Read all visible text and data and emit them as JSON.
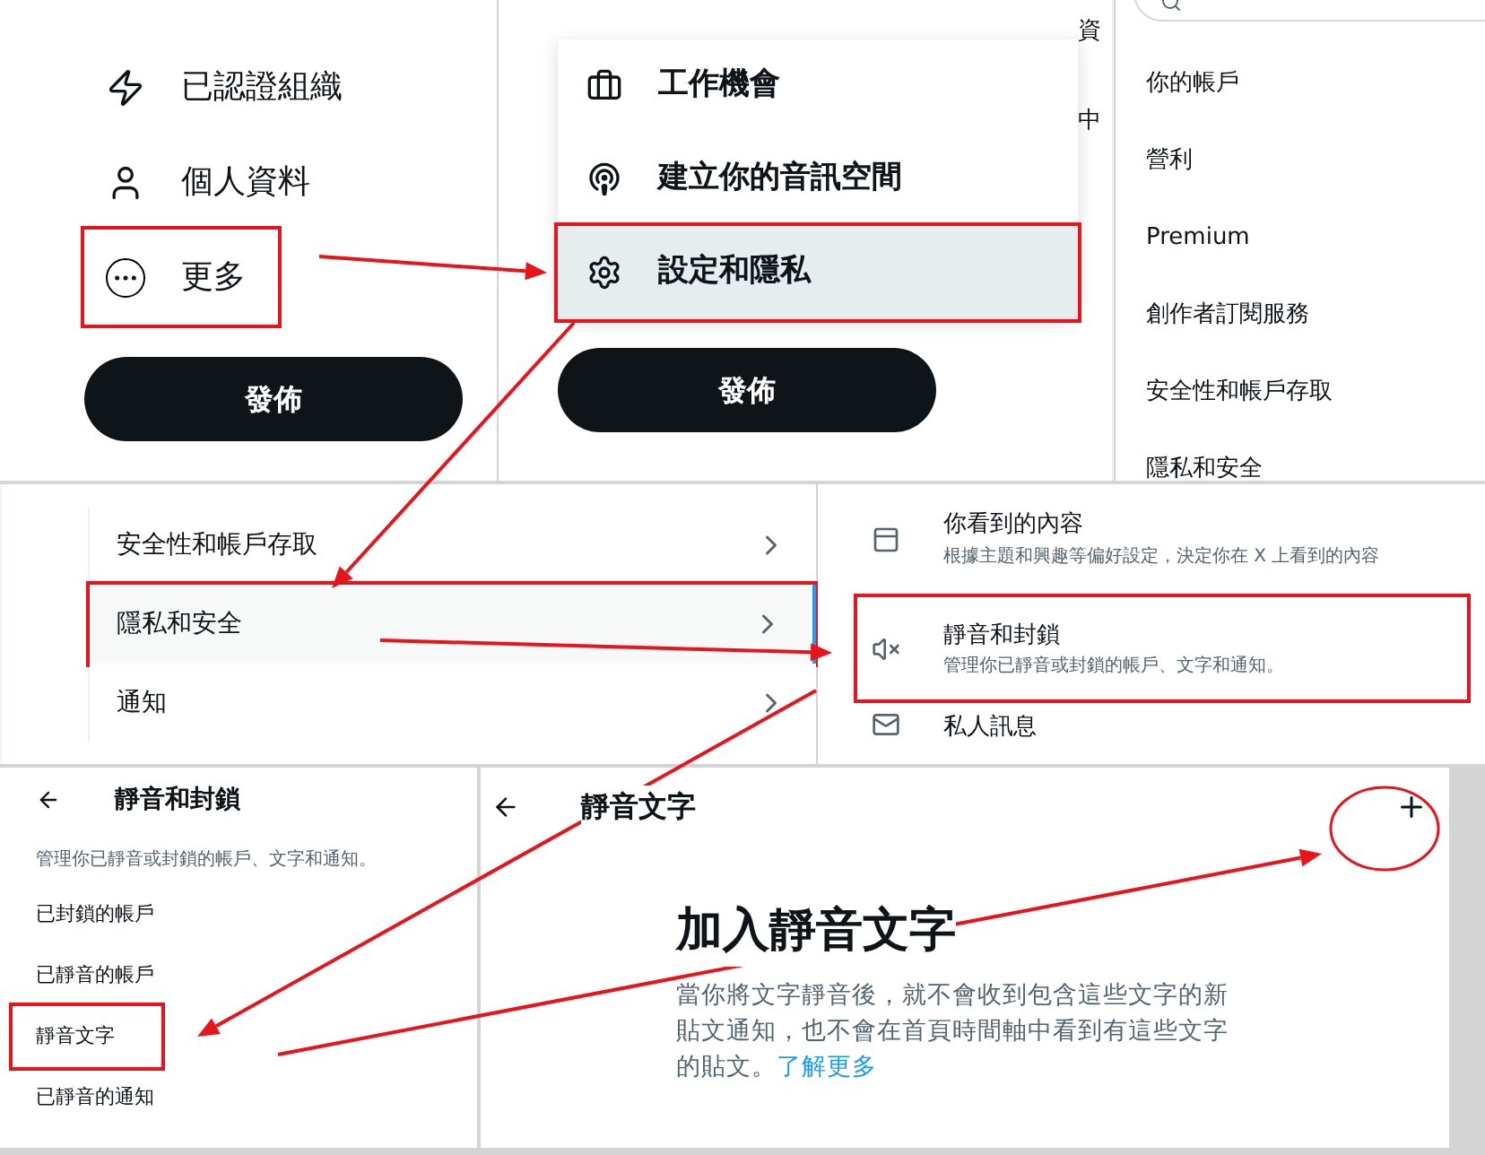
{
  "profile_menu": {
    "items": [
      {
        "label": "已認證組織",
        "annotated": false
      },
      {
        "label": "個人資料",
        "annotated": false
      },
      {
        "label": "更多",
        "annotated": true
      }
    ],
    "post_button": "發佈"
  },
  "more_menu": {
    "items": [
      {
        "label": "工作機會",
        "selected": false,
        "annotated": false
      },
      {
        "label": "建立你的音訊空間",
        "selected": false,
        "annotated": false
      },
      {
        "label": "設定和隱私",
        "selected": true,
        "annotated": true
      }
    ],
    "post_button": "發佈",
    "side_fragments": [
      "資",
      "中"
    ]
  },
  "settings_nav": {
    "items": [
      "你的帳戶",
      "營利",
      "Premium",
      "創作者訂閱服務",
      "安全性和帳戶存取",
      "隱私和安全"
    ]
  },
  "settings_list": {
    "items": [
      {
        "label": "安全性和帳戶存取",
        "selected": false,
        "annotated": false
      },
      {
        "label": "隱私和安全",
        "selected": true,
        "annotated": true
      },
      {
        "label": "通知",
        "selected": false,
        "annotated": false
      }
    ]
  },
  "privacy_list": {
    "items": [
      {
        "title": "你看到的內容",
        "description": "根據主題和興趣等偏好設定，決定你在 X 上看到的內容",
        "annotated": false
      },
      {
        "title": "靜音和封鎖",
        "description": "管理你已靜音或封鎖的帳戶、文字和通知。",
        "annotated": true
      },
      {
        "title": "私人訊息",
        "annotated": false
      }
    ]
  },
  "mute_block": {
    "title": "靜音和封鎖",
    "description": "管理你已靜音或封鎖的帳戶、文字和通知。",
    "items": [
      {
        "label": "已封鎖的帳戶",
        "annotated": false
      },
      {
        "label": "已靜音的帳戶",
        "annotated": false
      },
      {
        "label": "靜音文字",
        "annotated": true
      },
      {
        "label": "已靜音的通知",
        "annotated": false
      }
    ]
  },
  "muted_words": {
    "title": "靜音文字",
    "add_annotated": true,
    "empty_title": "加入靜音文字",
    "empty_body": "當你將文字靜音後，就不會收到包含這些文字的新貼文通知，也不會在首頁時間軸中看到有這些文字的貼文。",
    "learn_more": "了解更多"
  }
}
